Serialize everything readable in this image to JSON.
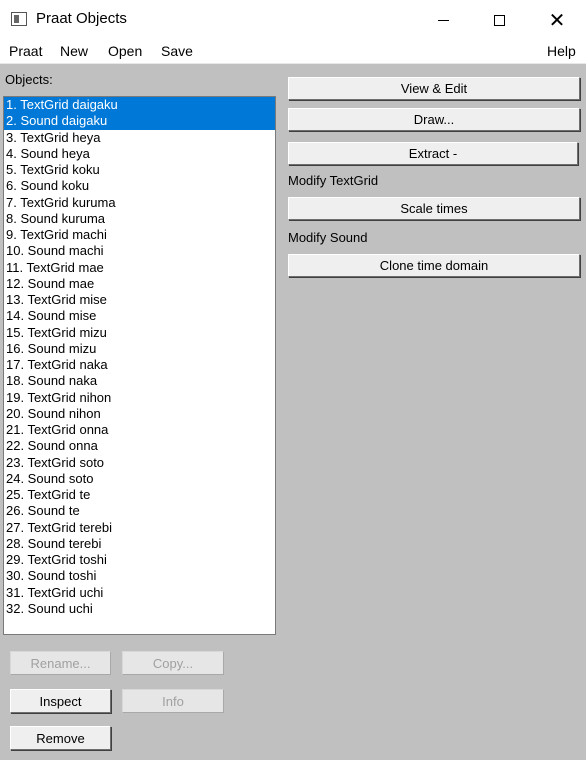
{
  "window": {
    "title": "Praat Objects",
    "close_glyph": "✕"
  },
  "menu": [
    "Praat",
    "New",
    "Open",
    "Save",
    "Help"
  ],
  "objects_label": "Objects:",
  "objects": [
    {
      "label": "1. TextGrid daigaku",
      "selected": true
    },
    {
      "label": "2. Sound daigaku",
      "selected": true
    },
    {
      "label": "3. TextGrid heya",
      "selected": false
    },
    {
      "label": "4. Sound heya",
      "selected": false
    },
    {
      "label": "5. TextGrid koku",
      "selected": false
    },
    {
      "label": "6. Sound koku",
      "selected": false
    },
    {
      "label": "7. TextGrid kuruma",
      "selected": false
    },
    {
      "label": "8. Sound kuruma",
      "selected": false
    },
    {
      "label": "9. TextGrid machi",
      "selected": false
    },
    {
      "label": "10. Sound machi",
      "selected": false
    },
    {
      "label": "11. TextGrid mae",
      "selected": false
    },
    {
      "label": "12. Sound mae",
      "selected": false
    },
    {
      "label": "13. TextGrid mise",
      "selected": false
    },
    {
      "label": "14. Sound mise",
      "selected": false
    },
    {
      "label": "15. TextGrid mizu",
      "selected": false
    },
    {
      "label": "16. Sound mizu",
      "selected": false
    },
    {
      "label": "17. TextGrid naka",
      "selected": false
    },
    {
      "label": "18. Sound naka",
      "selected": false
    },
    {
      "label": "19. TextGrid nihon",
      "selected": false
    },
    {
      "label": "20. Sound nihon",
      "selected": false
    },
    {
      "label": "21. TextGrid onna",
      "selected": false
    },
    {
      "label": "22. Sound onna",
      "selected": false
    },
    {
      "label": "23. TextGrid soto",
      "selected": false
    },
    {
      "label": "24. Sound soto",
      "selected": false
    },
    {
      "label": "25. TextGrid te",
      "selected": false
    },
    {
      "label": "26. Sound te",
      "selected": false
    },
    {
      "label": "27. TextGrid terebi",
      "selected": false
    },
    {
      "label": "28. Sound terebi",
      "selected": false
    },
    {
      "label": "29. TextGrid toshi",
      "selected": false
    },
    {
      "label": "30. Sound toshi",
      "selected": false
    },
    {
      "label": "31. TextGrid uchi",
      "selected": false
    },
    {
      "label": "32. Sound uchi",
      "selected": false
    }
  ],
  "actions": {
    "view_edit": "View & Edit",
    "draw": "Draw...",
    "extract": "Extract -",
    "modify_textgrid_label": "Modify TextGrid",
    "scale_times": "Scale times",
    "modify_sound_label": "Modify Sound",
    "clone_time_domain": "Clone time domain"
  },
  "bottom_buttons": {
    "rename": "Rename...",
    "copy": "Copy...",
    "inspect": "Inspect",
    "info": "Info",
    "remove": "Remove"
  },
  "colors": {
    "selection": "#0078d7",
    "background": "#c0c0c0"
  }
}
